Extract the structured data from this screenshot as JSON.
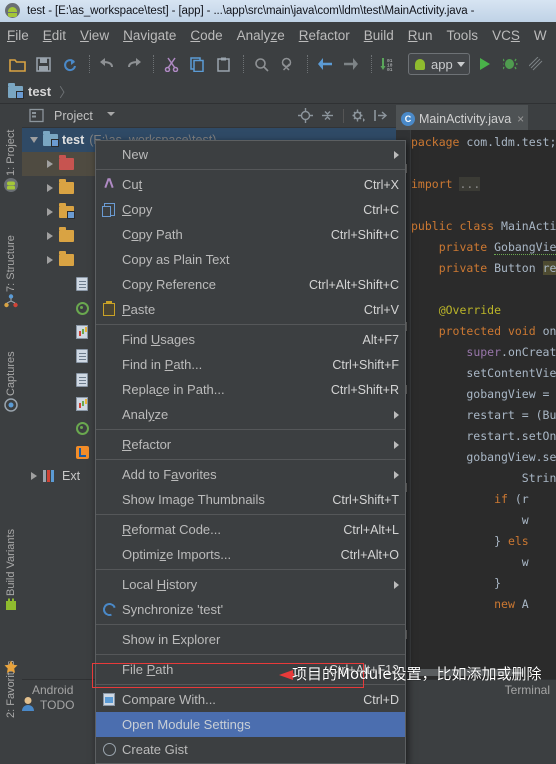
{
  "titlebar": {
    "icon": "android-studio-icon",
    "text": "test - [E:\\as_workspace\\test] - [app] - ...\\app\\src\\main\\java\\com\\ldm\\test\\MainActivity.java -"
  },
  "menubar": {
    "items": [
      {
        "label": "File",
        "mnemonic": "F"
      },
      {
        "label": "Edit",
        "mnemonic": "E"
      },
      {
        "label": "View",
        "mnemonic": "V"
      },
      {
        "label": "Navigate",
        "mnemonic": "N"
      },
      {
        "label": "Code",
        "mnemonic": "C"
      },
      {
        "label": "Analyze",
        "mnemonic": "z"
      },
      {
        "label": "Refactor",
        "mnemonic": "R"
      },
      {
        "label": "Build",
        "mnemonic": "B"
      },
      {
        "label": "Run",
        "mnemonic": "R"
      },
      {
        "label": "Tools",
        "mnemonic": "T"
      },
      {
        "label": "VCS",
        "mnemonic": "S"
      },
      {
        "label": "W",
        "mnemonic": "W"
      }
    ]
  },
  "toolbar": {
    "icons": [
      "open-folder-icon",
      "save-all-icon",
      "sync-icon",
      "undo-icon",
      "redo-icon",
      "cut-icon",
      "copy-icon",
      "paste-icon",
      "find-icon",
      "replace-icon",
      "back-icon",
      "forward-icon",
      "sdk-manager-icon"
    ],
    "run_config_label": "app",
    "run_config_icon": "android-icon",
    "run_icon": "run-icon",
    "debug_icon": "debug-icon",
    "coverage_icon": "coverage-icon",
    "avd_icon": "avd-manager-icon",
    "settings_icon": "project-structure-icon"
  },
  "breadcrumb": {
    "root": "test",
    "icon": "module-folder-icon"
  },
  "left_strip": {
    "items": [
      {
        "label": "1: Project",
        "icon": "android-project-icon"
      },
      {
        "label": "7: Structure",
        "icon": "structure-icon"
      },
      {
        "label": "Captures",
        "icon": "captures-icon"
      },
      {
        "label": "Build Variants",
        "icon": "build-variants-icon"
      },
      {
        "label": "2: Favorites",
        "icon": "favorites-star-icon"
      }
    ]
  },
  "project_panel": {
    "header": {
      "title": "Project",
      "view_icon": "project-view-icon",
      "dropdown_icon": "chevron-down-icon",
      "locate_icon": "scroll-from-source-icon",
      "collapse_icon": "collapse-all-icon",
      "settings_icon": "gear-icon",
      "hide_icon": "hide-panel-icon"
    },
    "tree": [
      {
        "label": "test",
        "path": "(E:\\as_workspace\\test)",
        "icon": "module-folder-icon",
        "expanded": true,
        "depth": 0,
        "selected": true
      },
      {
        "label": "",
        "icon": "red-folder-icon",
        "expanded": false,
        "depth": 1,
        "highlighted": true
      },
      {
        "label": "",
        "icon": "folder-icon",
        "expanded": false,
        "depth": 1
      },
      {
        "label": "",
        "icon": "module-folder-icon",
        "expanded": false,
        "depth": 1
      },
      {
        "label": "",
        "icon": "folder-icon",
        "expanded": false,
        "depth": 1
      },
      {
        "label": "",
        "icon": "folder-icon",
        "expanded": false,
        "depth": 1
      },
      {
        "label": "",
        "icon": "file-icon",
        "depth": 2
      },
      {
        "label": "",
        "icon": "gradle-icon",
        "depth": 2
      },
      {
        "label": "",
        "icon": "properties-file-icon",
        "depth": 2
      },
      {
        "label": "",
        "icon": "file-icon",
        "depth": 2
      },
      {
        "label": "",
        "icon": "file-icon",
        "depth": 2
      },
      {
        "label": "",
        "icon": "properties-file-icon",
        "depth": 2
      },
      {
        "label": "",
        "icon": "gradle-icon",
        "depth": 2
      },
      {
        "label": "",
        "icon": "iml-file-icon",
        "depth": 2
      },
      {
        "label": "Ext",
        "icon": "external-libraries-icon",
        "expanded": false,
        "depth": 0
      }
    ]
  },
  "editor": {
    "tab": {
      "name": "MainActivity.java",
      "icon": "java-class-icon",
      "close": "×"
    },
    "code_lines": [
      "package com.ldm.test;",
      "",
      "import ...",
      "",
      "public class MainActi",
      "    private GobangVie",
      "    private Button re",
      "",
      "    @Override",
      "    protected void on",
      "        super.onCreat",
      "        setContentVie",
      "        gobangView = ",
      "        restart = (Bu",
      "        restart.setOn",
      "        gobangView.se",
      "                Strin",
      "            if (r",
      "                w",
      "            } els",
      "                w",
      "            }",
      "            new A"
    ]
  },
  "context_menu": {
    "items": [
      {
        "label": "New",
        "mnemonic": "",
        "accel": "",
        "submenu": true,
        "icon": ""
      },
      {
        "separator": true
      },
      {
        "label": "Cut",
        "mnemonic": "t",
        "accel": "Ctrl+X",
        "icon": "cut-icon"
      },
      {
        "label": "Copy",
        "mnemonic": "C",
        "accel": "Ctrl+C",
        "icon": "copy-icon"
      },
      {
        "label": "Copy Path",
        "mnemonic": "o",
        "accel": "Ctrl+Shift+C",
        "icon": ""
      },
      {
        "label": "Copy as Plain Text",
        "mnemonic": "",
        "accel": "",
        "icon": ""
      },
      {
        "label": "Copy Reference",
        "mnemonic": "y",
        "accel": "Ctrl+Alt+Shift+C",
        "icon": ""
      },
      {
        "label": "Paste",
        "mnemonic": "P",
        "accel": "Ctrl+V",
        "icon": "paste-icon"
      },
      {
        "separator": true
      },
      {
        "label": "Find Usages",
        "mnemonic": "U",
        "accel": "Alt+F7",
        "icon": ""
      },
      {
        "label": "Find in Path...",
        "mnemonic": "P",
        "accel": "Ctrl+Shift+F",
        "icon": ""
      },
      {
        "label": "Replace in Path...",
        "mnemonic": "c",
        "accel": "Ctrl+Shift+R",
        "icon": ""
      },
      {
        "label": "Analyze",
        "mnemonic": "y",
        "accel": "",
        "submenu": true,
        "icon": ""
      },
      {
        "separator": true
      },
      {
        "label": "Refactor",
        "mnemonic": "R",
        "accel": "",
        "submenu": true,
        "icon": ""
      },
      {
        "separator": true
      },
      {
        "label": "Add to Favorites",
        "mnemonic": "a",
        "accel": "",
        "submenu": true,
        "icon": ""
      },
      {
        "label": "Show Image Thumbnails",
        "mnemonic": "",
        "accel": "Ctrl+Shift+T",
        "icon": ""
      },
      {
        "separator": true
      },
      {
        "label": "Reformat Code...",
        "mnemonic": "R",
        "accel": "Ctrl+Alt+L",
        "icon": ""
      },
      {
        "label": "Optimize Imports...",
        "mnemonic": "z",
        "accel": "Ctrl+Alt+O",
        "icon": ""
      },
      {
        "separator": true
      },
      {
        "label": "Local History",
        "mnemonic": "H",
        "accel": "",
        "submenu": true,
        "icon": ""
      },
      {
        "label": "Synchronize 'test'",
        "mnemonic": "",
        "accel": "",
        "icon": "sync-icon"
      },
      {
        "separator": true
      },
      {
        "label": "Show in Explorer",
        "mnemonic": "",
        "accel": "",
        "icon": ""
      },
      {
        "separator": true
      },
      {
        "label": "File Path",
        "mnemonic": "P",
        "accel": "Ctrl+Alt+F12",
        "icon": ""
      },
      {
        "separator": true
      },
      {
        "label": "Compare With...",
        "mnemonic": "",
        "accel": "Ctrl+D",
        "icon": "compare-icon"
      },
      {
        "label": "Open Module Settings",
        "mnemonic": "",
        "accel": "",
        "icon": "",
        "selected": true
      },
      {
        "label": "Create Gist",
        "mnemonic": "",
        "accel": "",
        "icon": "gist-icon"
      }
    ]
  },
  "annotation": {
    "note_text": "项目的Module设置，比如添加或删除",
    "highlight_color": "#e83a3a",
    "selection_color": "#4b6eaf"
  },
  "status_bar": {
    "left_label": "Android",
    "todo_label": "TODO",
    "todo_icon": "todo-icon",
    "terminal_label": "Terminal"
  }
}
